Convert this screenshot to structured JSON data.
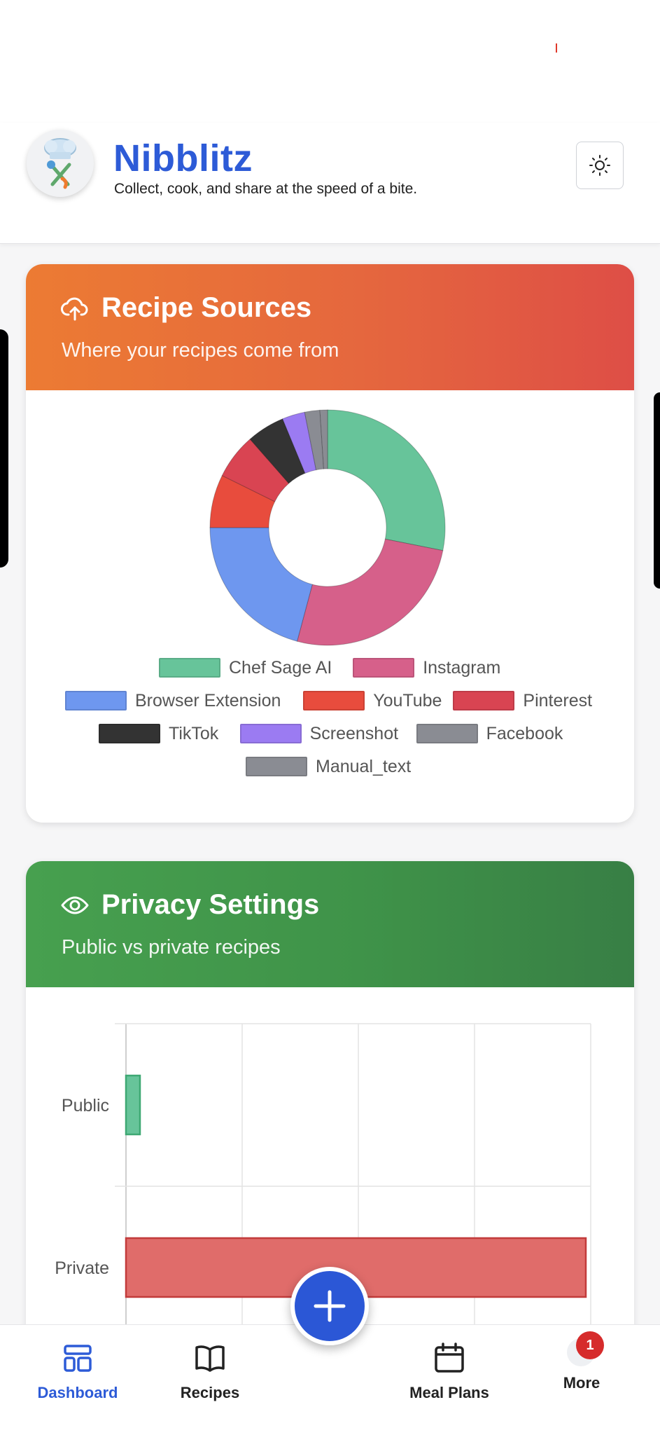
{
  "app": {
    "title": "Nibblitz",
    "tagline": "Collect, cook, and share at the speed of a bite.",
    "theme_icon": "sun-icon"
  },
  "sources_card": {
    "title": "Recipe Sources",
    "subtitle": "Where your recipes come from",
    "icon": "cloud-upload-icon"
  },
  "privacy_card": {
    "title": "Privacy Settings",
    "subtitle": "Public vs private recipes",
    "icon": "eye-icon"
  },
  "chart_data": [
    {
      "type": "pie",
      "donut": true,
      "legend_position": "bottom",
      "categories": [
        "Chef Sage AI",
        "Instagram",
        "Browser Extension",
        "YouTube",
        "Pinterest",
        "TikTok",
        "Screenshot",
        "Facebook",
        "Manual_text"
      ],
      "values": [
        27,
        25,
        20,
        7,
        6,
        5,
        3,
        2,
        1
      ],
      "colors": [
        "#67c49a",
        "#d6608a",
        "#6e97ef",
        "#e84c3d",
        "#d94452",
        "#333333",
        "#9b7bf2",
        "#8a8c93",
        "#8a8c93"
      ]
    },
    {
      "type": "bar",
      "orientation": "horizontal",
      "categories": [
        "Public",
        "Private"
      ],
      "values": [
        1,
        37
      ],
      "xlim": [
        0,
        37
      ],
      "grid": true,
      "colors": [
        "#67c49a",
        "#e06c6a"
      ],
      "border_colors": [
        "#3ea873",
        "#c23b3b"
      ]
    }
  ],
  "nav": {
    "items": [
      {
        "label": "Dashboard",
        "icon": "dashboard-icon",
        "active": true
      },
      {
        "label": "Recipes",
        "icon": "book-icon",
        "active": false
      },
      {
        "label": "Meal Plans",
        "icon": "calendar-icon",
        "active": false
      },
      {
        "label": "More",
        "icon": "more-icon",
        "active": false
      }
    ],
    "add_icon": "plus-icon",
    "more_badge": "1"
  }
}
